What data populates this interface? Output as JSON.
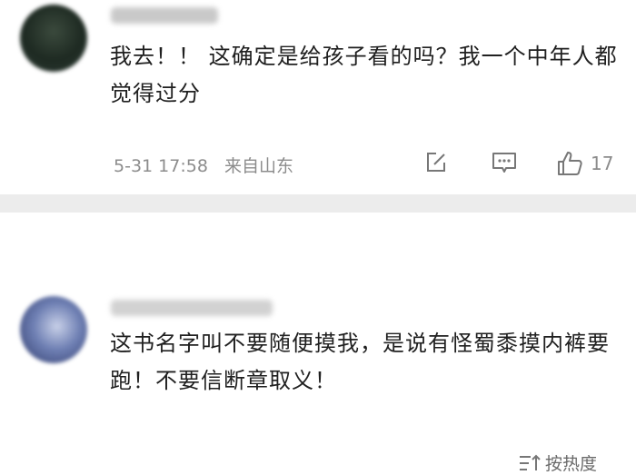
{
  "comments": [
    {
      "text": "我去！！ 这确定是给孩子看的吗？我一个中年人都觉得过分",
      "date": "5-31 17:58",
      "location": "来自山东",
      "like_count": "17"
    },
    {
      "text": "这书名字叫不要随便摸我，是说有怪蜀黍摸内裤要跑！不要信断章取义！"
    }
  ],
  "sort": {
    "label": "按热度"
  },
  "icons": {
    "edit": "edit-icon",
    "reply": "comment-icon",
    "like": "thumbs-up-icon",
    "sort": "sort-icon"
  }
}
